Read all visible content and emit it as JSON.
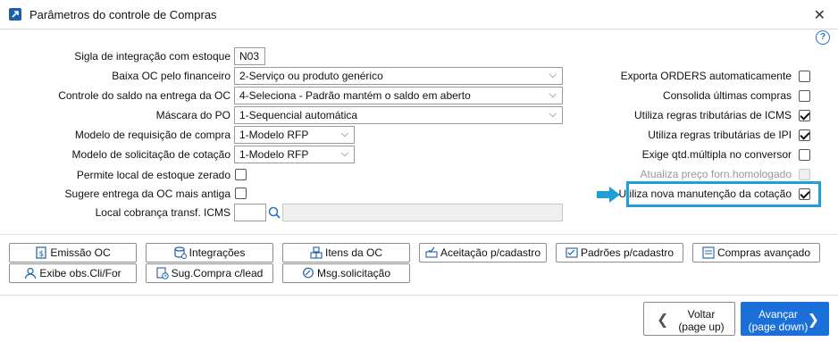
{
  "window": {
    "title": "Parâmetros do controle de Compras",
    "help_glyph": "?",
    "close_glyph": "✕"
  },
  "left_form": {
    "sigla": {
      "label": "Sigla de integração com estoque",
      "value": "N03"
    },
    "baixa_oc": {
      "label": "Baixa OC pelo financeiro",
      "value": "2-Serviço ou produto genérico"
    },
    "controle_saldo": {
      "label": "Controle do saldo na entrega da OC",
      "value": "4-Seleciona - Padrão mantém o saldo em aberto"
    },
    "mascara_po": {
      "label": "Máscara do PO",
      "value": "1-Sequencial automática"
    },
    "modelo_requisicao": {
      "label": "Modelo de requisição de compra",
      "value": "1-Modelo RFP"
    },
    "modelo_solicitacao": {
      "label": "Modelo de solicitação de cotação",
      "value": "1-Modelo RFP"
    },
    "permite_local": {
      "label": "Permite local de estoque zerado",
      "checked": false
    },
    "sugere_entrega": {
      "label": "Sugere entrega da OC mais antiga",
      "checked": false
    },
    "local_cobranca": {
      "label": "Local cobrança transf. ICMS",
      "value": "",
      "description": ""
    }
  },
  "right_options": [
    {
      "label": "Exporta ORDERS automaticamente",
      "checked": false,
      "disabled": false
    },
    {
      "label": "Consolida últimas compras",
      "checked": false,
      "disabled": false
    },
    {
      "label": "Utiliza regras tributárias de ICMS",
      "checked": true,
      "disabled": false
    },
    {
      "label": "Utiliza regras tributárias de IPI",
      "checked": true,
      "disabled": false
    },
    {
      "label": "Exige qtd.múltipla no conversor",
      "checked": false,
      "disabled": false
    },
    {
      "label": "Atualiza preço forn.homologado",
      "checked": false,
      "disabled": true
    },
    {
      "label": "Utiliza nova manutenção da cotação",
      "checked": true,
      "disabled": false,
      "highlighted": true
    }
  ],
  "action_buttons": {
    "emissao_oc": "Emissão OC",
    "integracoes": "Integrações",
    "itens_oc": "Itens da OC",
    "aceitacao": "Aceitação p/cadastro",
    "padroes": "Padrões p/cadastro",
    "compras_avancado": "Compras avançado",
    "exibe_obs": "Exibe obs.Cli/For",
    "sug_compra": "Sug.Compra c/lead",
    "msg_solicitacao": "Msg.solicitação"
  },
  "nav": {
    "back": {
      "line1": "Voltar",
      "line2": "(page up)"
    },
    "next": {
      "line1": "Avançar",
      "line2": "(page down)"
    }
  },
  "colors": {
    "accent": "#1b6fd8",
    "highlight": "#1e9fd6"
  }
}
